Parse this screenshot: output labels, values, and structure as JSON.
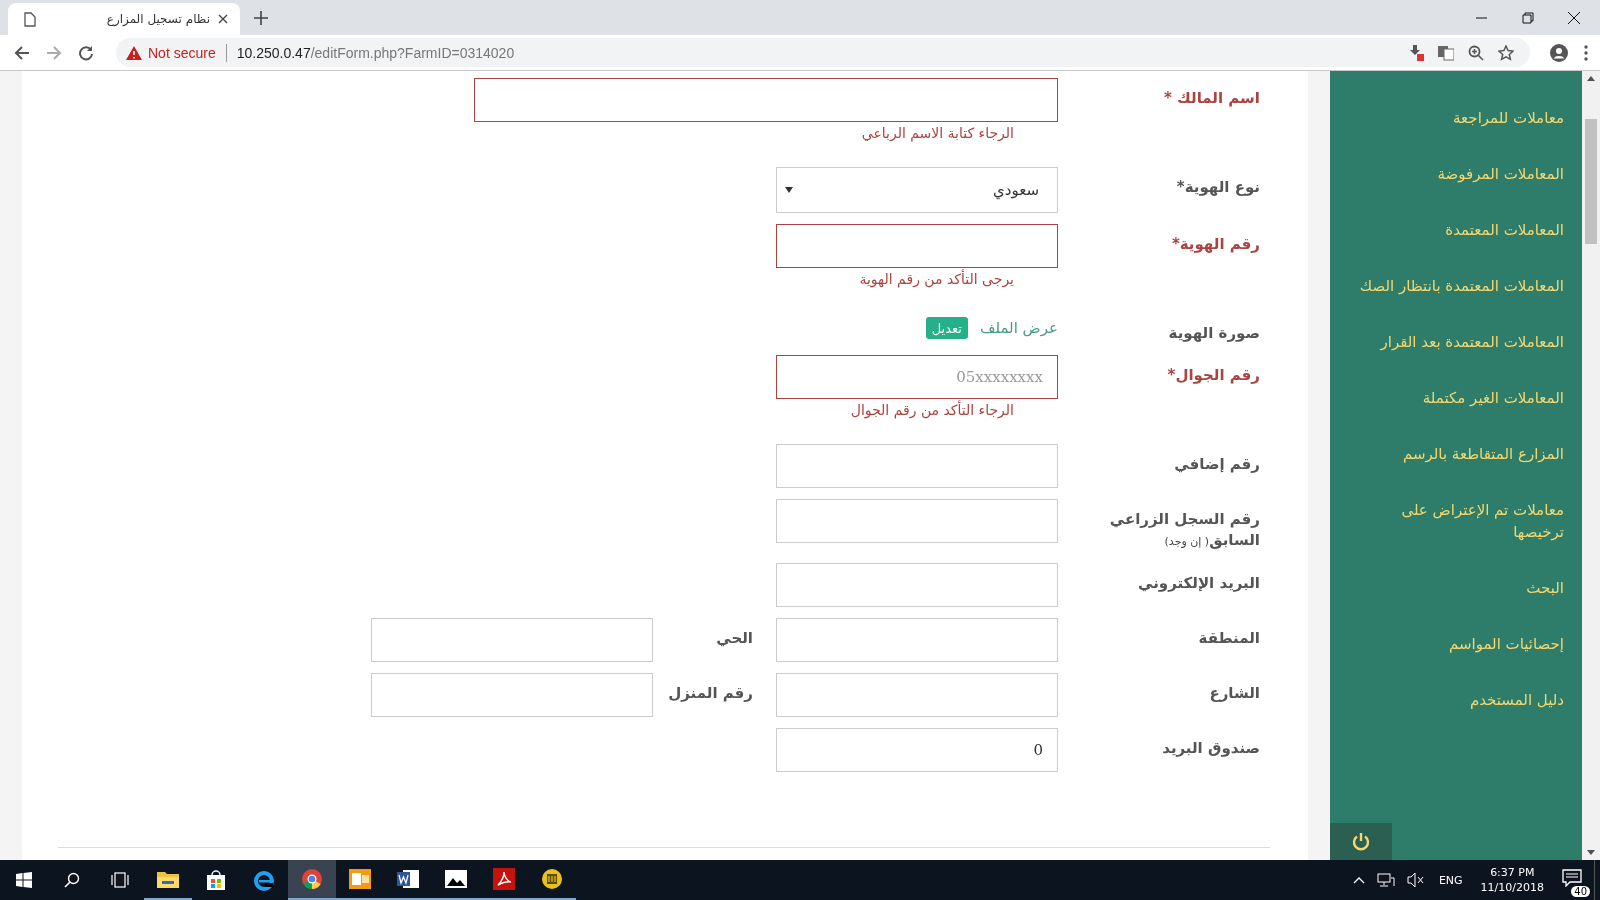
{
  "browser": {
    "tab_title": "نظام تسجيل المزارع",
    "security": "Not secure",
    "host": "10.250.0.47",
    "path": "/editForm.php?FarmID=0314020"
  },
  "form": {
    "rows": [
      {
        "fields": [
          {
            "kind": "wide",
            "label": "اسم المالك *",
            "invalid": true,
            "error": "الرجاء كتابة الاسم الرباعي"
          }
        ]
      },
      {
        "fields": [
          {
            "kind": "select",
            "label": "نوع الهوية*",
            "invalid": false,
            "value": "سعودي"
          }
        ]
      },
      {
        "fields": [
          {
            "kind": "text",
            "label": "رقم الهوية*",
            "invalid": true,
            "error": "يرجى التأكد من رقم الهوية"
          }
        ]
      },
      {
        "fields": [
          {
            "kind": "file",
            "label": "صورة الهوية",
            "invalid": false,
            "link": "عرض الملف",
            "button": "تعديل"
          }
        ]
      },
      {
        "fields": [
          {
            "kind": "text",
            "label": "رقم الجوال*",
            "invalid": true,
            "placeholder": "05xxxxxxxx",
            "error": "الرجاء التأكد من رقم الجوال"
          }
        ]
      },
      {
        "fields": [
          {
            "kind": "text",
            "label": "رقم إضافي",
            "invalid": false
          }
        ]
      },
      {
        "fields": [
          {
            "kind": "text",
            "label": "رقم السجل الزراعي السابق",
            "note": "( إن وجد)",
            "invalid": false
          }
        ]
      },
      {
        "fields": [
          {
            "kind": "text",
            "label": "البريد الإلكتروني",
            "invalid": false
          }
        ]
      },
      {
        "fields": [
          {
            "kind": "text",
            "label": "المنطقة",
            "invalid": false
          },
          {
            "kind": "text",
            "label": "الحي",
            "invalid": false
          }
        ]
      },
      {
        "fields": [
          {
            "kind": "text",
            "label": "الشارع",
            "invalid": false
          },
          {
            "kind": "text",
            "label": "رقم المنزل",
            "invalid": false
          }
        ]
      },
      {
        "fields": [
          {
            "kind": "text",
            "label": "صندوق البريد",
            "invalid": false,
            "value": "0"
          }
        ]
      }
    ]
  },
  "sidebar": {
    "items": [
      {
        "label": "معاملات للمراجعة"
      },
      {
        "label": "المعاملات المرفوضة"
      },
      {
        "label": "المعاملات المعتمدة"
      },
      {
        "label": "المعاملات المعتمدة بانتظار الصك"
      },
      {
        "label": "المعاملات المعتمدة بعد القرار"
      },
      {
        "label": "المعاملات الغير مكتملة"
      },
      {
        "label": "المزارع المتقاطعة بالرسم"
      },
      {
        "label": "معاملات تم الإعتراض على ترخيصها"
      },
      {
        "label": "البحث"
      },
      {
        "label": "إحصائيات المواسم"
      },
      {
        "label": "دليل المستخدم"
      }
    ]
  },
  "taskbar": {
    "apps": [
      {
        "kind": "folder",
        "running": true,
        "selected": false
      },
      {
        "kind": "store",
        "running": false,
        "selected": false
      },
      {
        "kind": "ie",
        "running": false,
        "selected": false
      },
      {
        "kind": "chrome",
        "running": true,
        "selected": true
      },
      {
        "kind": "outlook",
        "running": true,
        "selected": false
      },
      {
        "kind": "word",
        "running": true,
        "selected": false
      },
      {
        "kind": "photos",
        "running": true,
        "selected": false
      },
      {
        "kind": "acrobat",
        "running": true,
        "selected": false
      },
      {
        "kind": "coin",
        "running": true,
        "selected": false
      }
    ],
    "language": "ENG",
    "time": "6:37 PM",
    "date": "11/10/2018",
    "notifications": "40"
  }
}
